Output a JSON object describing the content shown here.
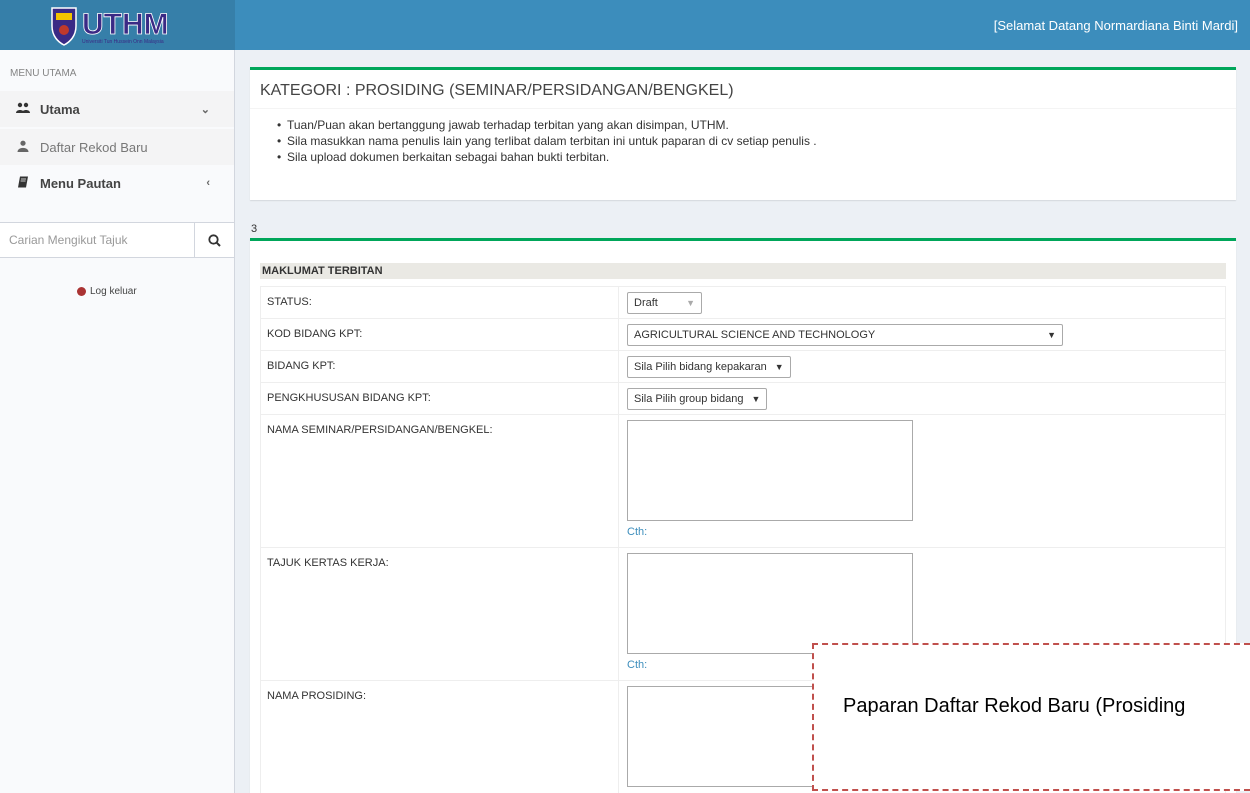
{
  "header": {
    "logo_text": "UTHM",
    "logo_subtitle": "Universiti Tun Hussein Onn Malaysia",
    "welcome": "[Selamat Datang Normardiana Binti Mardi]",
    "colors": {
      "bar": "#3c8dbc",
      "logo_bg": "#367fa9",
      "logo": "#3a2a85"
    }
  },
  "sidebar": {
    "menu_header": "MENU UTAMA",
    "items": [
      {
        "label": "Utama",
        "icon": "users-icon",
        "caret": "⌄"
      },
      {
        "label": "Daftar Rekod Baru",
        "icon": "user-icon"
      },
      {
        "label": "Menu Pautan",
        "icon": "book-icon",
        "caret": "‹"
      }
    ],
    "search_placeholder": "Carian Mengikut Tajuk",
    "logout": "Log keluar"
  },
  "main": {
    "category_title": "KATEGORI : PROSIDING (SEMINAR/PERSIDANGAN/BENGKEL)",
    "notes": [
      "Tuan/Puan akan bertanggung jawab terhadap terbitan yang akan disimpan, UTHM.",
      "Sila masukkan nama penulis lain yang terlibat dalam terbitan ini untuk paparan di cv setiap penulis .",
      "Sila upload dokumen berkaitan sebagai bahan bukti terbitan."
    ],
    "box_number": "3",
    "section_title": "MAKLUMAT TERBITAN",
    "fields": {
      "status": {
        "label": "STATUS:",
        "value": "Draft"
      },
      "kod_bidang": {
        "label": "KOD BIDANG KPT:",
        "value": "AGRICULTURAL SCIENCE AND TECHNOLOGY"
      },
      "bidang": {
        "label": "BIDANG KPT:",
        "value": "Sila Pilih bidang kepakaran"
      },
      "pengkhususan": {
        "label": "PENGKHUSUSAN BIDANG KPT:",
        "value": "Sila Pilih group bidang"
      },
      "nama_seminar": {
        "label": "NAMA SEMINAR/PERSIDANGAN/BENGKEL:",
        "hint": "Cth:"
      },
      "tajuk": {
        "label": "TAJUK KERTAS KERJA:",
        "hint": "Cth:"
      },
      "nama_prosiding": {
        "label": "NAMA PROSIDING:"
      }
    }
  },
  "annotation": {
    "text": "Paparan Daftar Rekod Baru (Prosiding"
  }
}
